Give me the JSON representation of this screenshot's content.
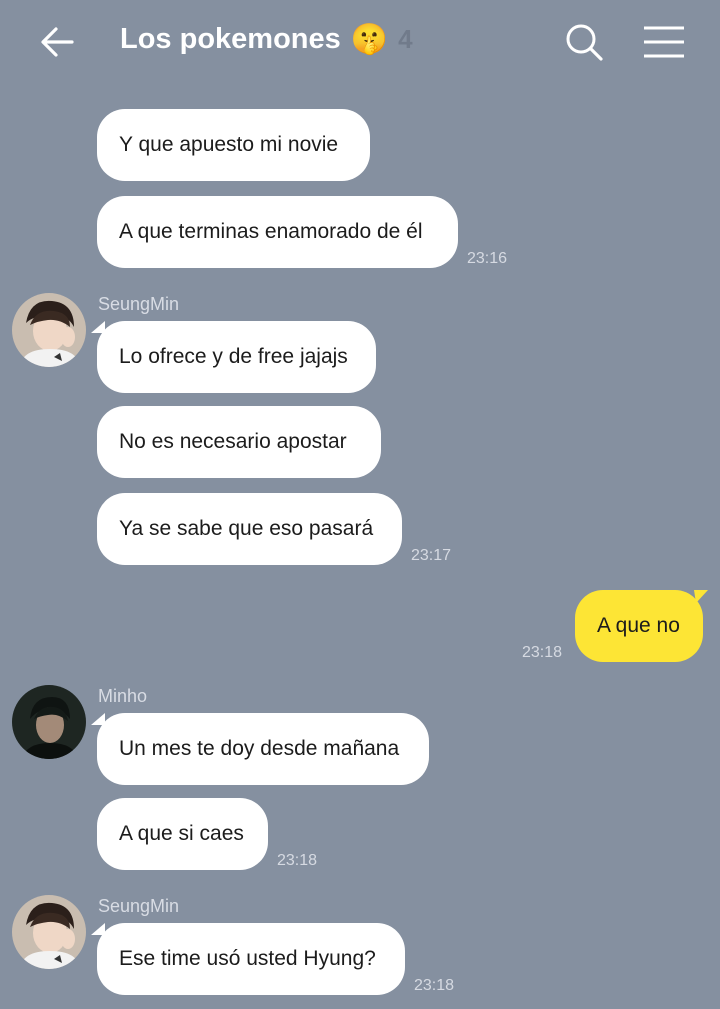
{
  "header": {
    "title": "Los pokemones",
    "emoji": "🤫",
    "member_count": "4"
  },
  "messages": [
    {
      "text": "Y que apuesto mi novie"
    },
    {
      "text": "A que terminas enamorado de él",
      "time": "23:16"
    },
    {
      "sender": "SeungMin",
      "text": "Lo ofrece y de free jajajs"
    },
    {
      "text": "No es necesario apostar"
    },
    {
      "text": "Ya se sabe que eso pasará",
      "time": "23:17"
    },
    {
      "text": "A que no",
      "time": "23:18",
      "mine": true
    },
    {
      "sender": "Minho",
      "text": "Un mes te doy desde mañana"
    },
    {
      "text": "A que si caes",
      "time": "23:18"
    },
    {
      "sender": "SeungMin",
      "text": "Ese time usó usted Hyung?",
      "time": "23:18"
    }
  ],
  "colors": {
    "background": "#8590a0",
    "bubble_other": "#ffffff",
    "bubble_mine": "#fde535"
  },
  "icons": {
    "back": "arrow-left-icon",
    "search": "search-icon",
    "menu": "hamburger-menu-icon"
  }
}
